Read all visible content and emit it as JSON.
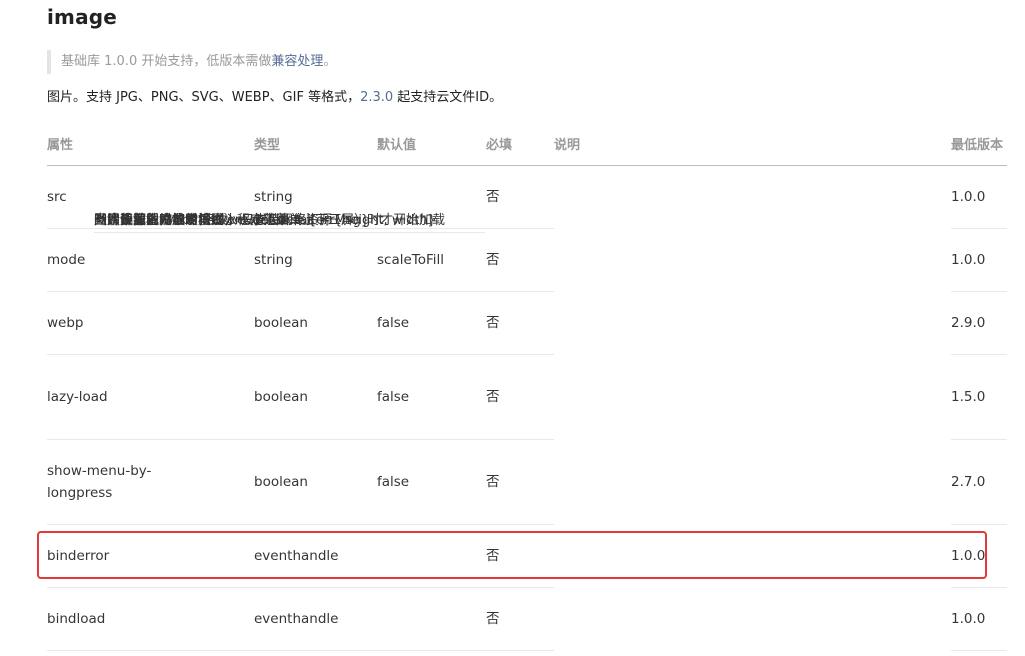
{
  "title": "image",
  "note": {
    "prefix": "基础库 1.0.0 开始支持，低版本需做",
    "link": "兼容处理",
    "suffix": "。"
  },
  "description": {
    "prefix": "图片。支持 JPG、PNG、SVG、WEBP、GIF 等格式，",
    "version": "2.3.0",
    "suffix": " 起支持云文件ID。"
  },
  "table": {
    "headers": [
      "属性",
      "类型",
      "默认值",
      "必填",
      "说明",
      "最低版本"
    ],
    "rows": [
      {
        "name": "src",
        "type": "string",
        "default": "",
        "required": "否",
        "desc": "图片资源地址",
        "version": "1.0.0"
      },
      {
        "name": "mode",
        "type": "string",
        "default": "scaleToFill",
        "required": "否",
        "desc": "图片裁剪、缩放的模式",
        "version": "1.0.0"
      },
      {
        "name": "webp",
        "type": "boolean",
        "default": "false",
        "required": "否",
        "desc": "默认不解析 webP 格式，只支持网络资源",
        "version": "2.9.0"
      },
      {
        "name": "lazy-load",
        "type": "boolean",
        "default": "false",
        "required": "否",
        "desc": "图片懒加载，在即将进入一定范围（上下三屏）时才开始加载",
        "version": "1.5.0"
      },
      {
        "name": "show-menu-by-longpress",
        "type": "boolean",
        "default": "false",
        "required": "否",
        "desc": "开启长按图片显示识别小程序码菜单",
        "version": "2.7.0"
      },
      {
        "name": "binderror",
        "type": "eventhandle",
        "default": "",
        "required": "否",
        "desc": "当错误发生时触发，event.detail = {errMsg}",
        "version": "1.0.0"
      },
      {
        "name": "bindload",
        "type": "eventhandle",
        "default": "",
        "required": "否",
        "desc": "当图片载入完毕时触发，event.detail = {height, width}",
        "version": "1.0.0"
      }
    ]
  },
  "highlight_color": "#e53935",
  "link_color": "#576b95"
}
